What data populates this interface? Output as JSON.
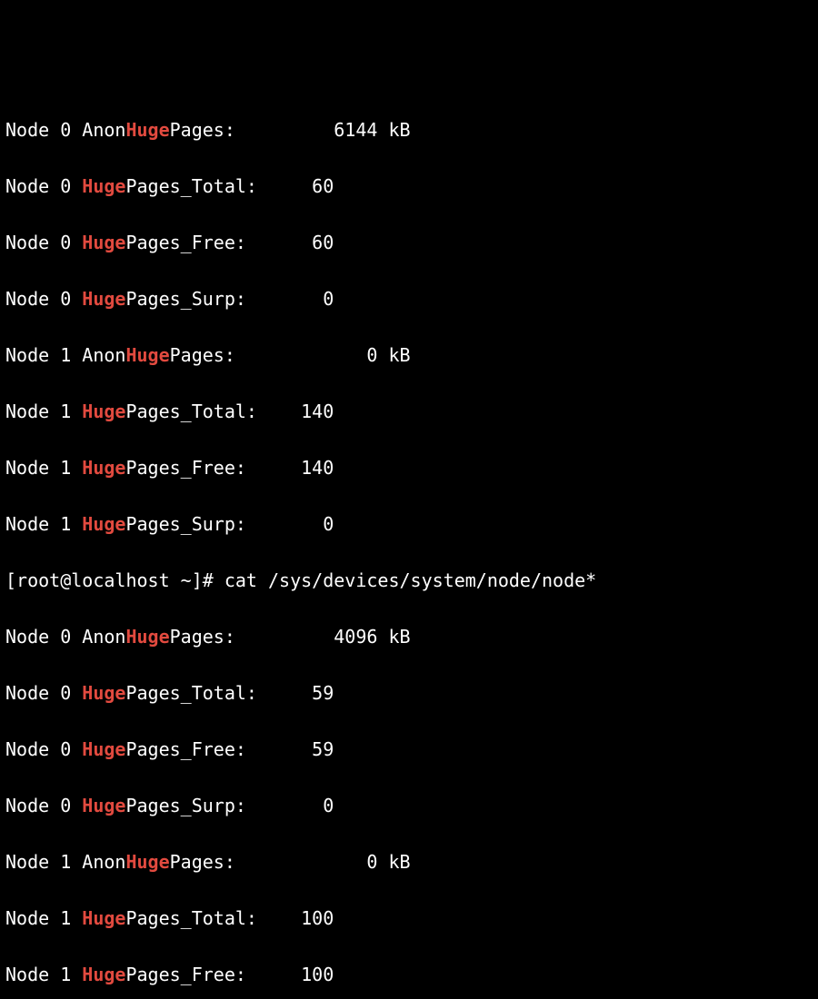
{
  "lines": [
    {
      "pre": "Node 0 Anon",
      "hl": "Huge",
      "post": "Pages:         6144 kB"
    },
    {
      "pre": "Node 0 ",
      "hl": "Huge",
      "post": "Pages_Total:     60"
    },
    {
      "pre": "Node 0 ",
      "hl": "Huge",
      "post": "Pages_Free:      60"
    },
    {
      "pre": "Node 0 ",
      "hl": "Huge",
      "post": "Pages_Surp:       0"
    },
    {
      "pre": "Node 1 Anon",
      "hl": "Huge",
      "post": "Pages:            0 kB"
    },
    {
      "pre": "Node 1 ",
      "hl": "Huge",
      "post": "Pages_Total:    140"
    },
    {
      "pre": "Node 1 ",
      "hl": "Huge",
      "post": "Pages_Free:     140"
    },
    {
      "pre": "Node 1 ",
      "hl": "Huge",
      "post": "Pages_Surp:       0"
    }
  ],
  "prompt": {
    "user_host": "[root@localhost ~]# ",
    "command": "cat /sys/devices/system/node/node*"
  },
  "lines2": [
    {
      "pre": "Node 0 Anon",
      "hl": "Huge",
      "post": "Pages:         4096 kB"
    },
    {
      "pre": "Node 0 ",
      "hl": "Huge",
      "post": "Pages_Total:     59"
    },
    {
      "pre": "Node 0 ",
      "hl": "Huge",
      "post": "Pages_Free:      59"
    },
    {
      "pre": "Node 0 ",
      "hl": "Huge",
      "post": "Pages_Surp:       0"
    },
    {
      "pre": "Node 1 Anon",
      "hl": "Huge",
      "post": "Pages:            0 kB"
    },
    {
      "pre": "Node 1 ",
      "hl": "Huge",
      "post": "Pages_Total:    100"
    },
    {
      "pre": "Node 1 ",
      "hl": "Huge",
      "post": "Pages_Free:     100"
    }
  ]
}
